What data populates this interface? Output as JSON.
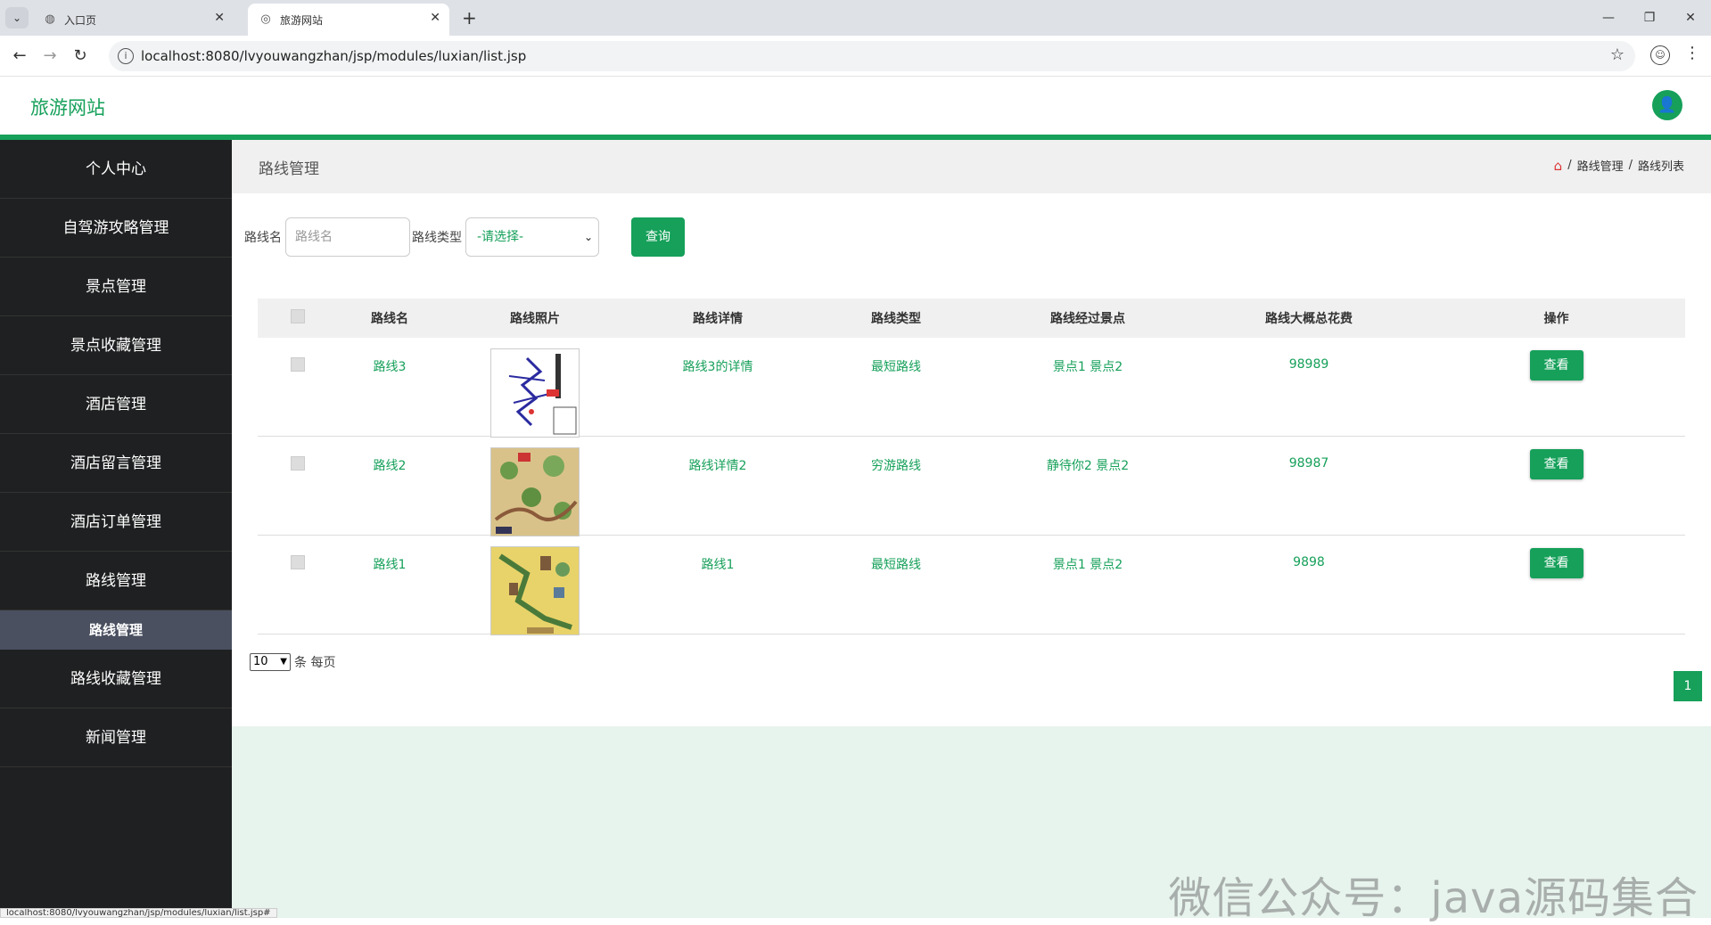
{
  "browser": {
    "tabs": [
      {
        "title": "入口页",
        "active": false
      },
      {
        "title": "旅游网站",
        "active": true
      }
    ],
    "url": "localhost:8080/lvyouwangzhan/jsp/modules/luxian/list.jsp",
    "status_url": "localhost:8080/lvyouwangzhan/jsp/modules/luxian/list.jsp#"
  },
  "header": {
    "brand": "旅游网站",
    "accent_color": "#16a05a"
  },
  "sidebar": {
    "items": [
      "个人中心",
      "自驾游攻略管理",
      "景点管理",
      "景点收藏管理",
      "酒店管理",
      "酒店留言管理",
      "酒店订单管理",
      "路线管理"
    ],
    "active_sub": "路线管理",
    "items_after": [
      "路线收藏管理",
      "新闻管理"
    ]
  },
  "page": {
    "title": "路线管理",
    "breadcrumb": [
      "路线管理",
      "路线列表"
    ]
  },
  "search": {
    "name_label": "路线名",
    "name_placeholder": "路线名",
    "type_label": "路线类型",
    "type_selected": "-请选择-",
    "query_button": "查询"
  },
  "table": {
    "headers": [
      "路线名",
      "路线照片",
      "路线详情",
      "路线类型",
      "路线经过景点",
      "路线大概总花费",
      "操作"
    ],
    "rows": [
      {
        "name": "路线3",
        "detail": "路线3的详情",
        "type": "最短路线",
        "spots": "景点1 景点2",
        "cost": "98989",
        "action": "查看"
      },
      {
        "name": "路线2",
        "detail": "路线详情2",
        "type": "穷游路线",
        "spots": "静待你2 景点2",
        "cost": "98987",
        "action": "查看"
      },
      {
        "name": "路线1",
        "detail": "路线1",
        "type": "最短路线",
        "spots": "景点1 景点2",
        "cost": "9898",
        "action": "查看"
      }
    ]
  },
  "pagination": {
    "page_size": "10",
    "per_page_label": "条 每页",
    "current_page": "1"
  },
  "watermark": "微信公众号：java源码集合"
}
